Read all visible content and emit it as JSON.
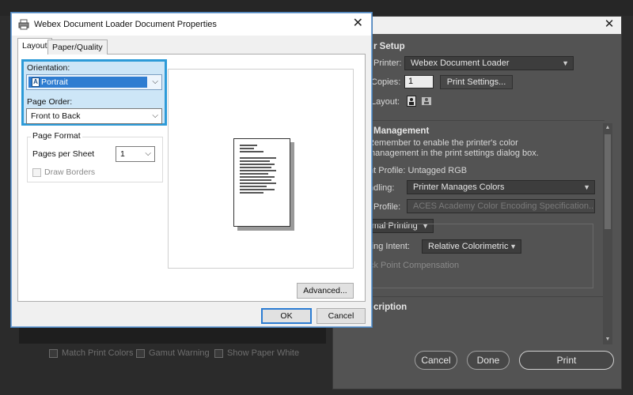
{
  "properties_dialog": {
    "title": "Webex Document Loader Document Properties",
    "close_glyph": "✕",
    "tabs": [
      {
        "label": "Layout",
        "active": true
      },
      {
        "label": "Paper/Quality",
        "active": false
      }
    ],
    "orientation": {
      "label": "Orientation:",
      "value": "Portrait"
    },
    "page_order": {
      "label": "Page Order:",
      "value": "Front to Back"
    },
    "page_format": {
      "legend": "Page Format",
      "pages_per_sheet_label": "Pages per Sheet",
      "pages_per_sheet_value": "1",
      "draw_borders_label": "Draw Borders"
    },
    "advanced_label": "Advanced...",
    "ok_label": "OK",
    "cancel_label": "Cancel"
  },
  "print_dialog": {
    "close_glyph": "✕",
    "setup_title": "r Setup",
    "printer_label": "Printer:",
    "printer_value": "Webex Document Loader",
    "copies_label": "Copies:",
    "copies_value": "1",
    "print_settings_label": "Print Settings...",
    "layout_label": "Layout:",
    "color_mgmt_title": "Management",
    "reminder_line1": "Remember to enable the printer's color",
    "reminder_line2": "management in the print settings dialog box.",
    "profile_text": "nt Profile: Untagged RGB",
    "handling_label": "ndling:",
    "handling_value": "Printer Manages Colors",
    "printer_profile_label": "Profile:",
    "printer_profile_value": "ACES Academy Color Encoding Specification...",
    "normal_printing_value": "rmal Printing",
    "rendering_intent_label": "ring Intent:",
    "rendering_intent_value": "Relative Colorimetric",
    "black_point_label": "ck Point Compensation",
    "description_title": "cription",
    "checks": [
      "Match Print Colors",
      "Gamut Warning",
      "Show Paper White"
    ],
    "cancel_label": "Cancel",
    "done_label": "Done",
    "print_label": "Print"
  },
  "colors": {
    "highlight_border": "#2d9bd8",
    "selection": "#2f7dd1",
    "dark_panel": "#535353"
  }
}
